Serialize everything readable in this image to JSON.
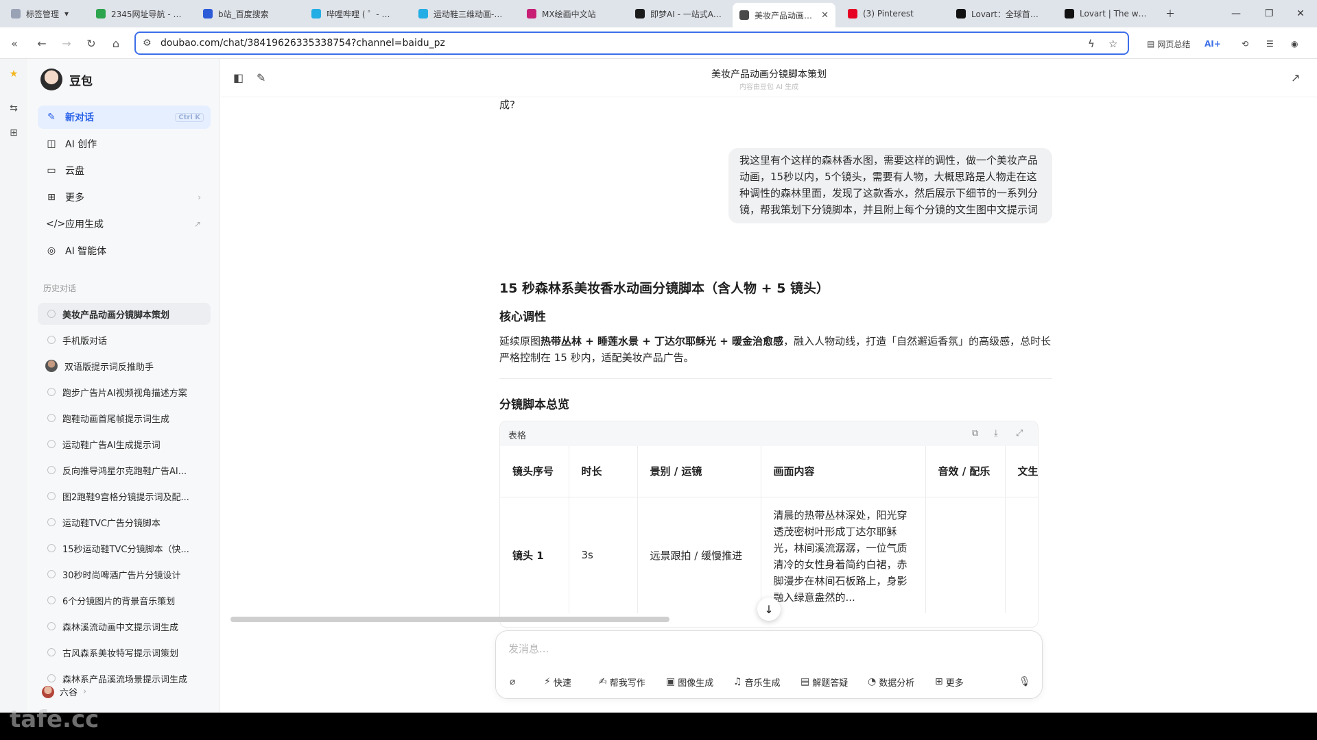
{
  "browser": {
    "bookmarks_label": "标签管理",
    "tabs": [
      {
        "label": "2345网址导航 - 致力...",
        "color": "#2da44e"
      },
      {
        "label": "b站_百度搜索",
        "color": "#2c5bd8"
      },
      {
        "label": "哔哩哔哩 ( ゜- ゜)つロ",
        "color": "#23ade5"
      },
      {
        "label": "运动鞋三维动画-哔哩...",
        "color": "#23ade5"
      },
      {
        "label": "MX绘画中文站",
        "color": "#c81e76"
      },
      {
        "label": "即梦AI - 一站式AI创...",
        "color": "#1b1b1b"
      },
      {
        "label": "美妆产品动画分...",
        "color": "#4a4a4a",
        "active": true
      },
      {
        "label": "(3) Pinterest",
        "color": "#e60023"
      },
      {
        "label": "Lovart：全球首个AI...",
        "color": "#111111"
      },
      {
        "label": "Lovart | The world's...",
        "color": "#111111"
      }
    ],
    "url": "doubao.com/chat/38419626335338754?channel=baidu_pz",
    "page_summary_label": "网页总结",
    "ai_label": "AI+"
  },
  "sidebar": {
    "brand": "豆包",
    "nav": [
      {
        "label": "新对话",
        "icon": "✎",
        "kbd": "Ctrl K",
        "active": true
      },
      {
        "label": "AI 创作",
        "icon": "◫"
      },
      {
        "label": "云盘",
        "icon": "▭"
      },
      {
        "label": "更多",
        "icon": "⊞",
        "arrow": "›"
      },
      {
        "label": "应用生成",
        "icon": "</>",
        "arrow": "↗"
      },
      {
        "label": "AI 智能体",
        "icon": "◎"
      }
    ],
    "history_title": "历史对话",
    "history": [
      {
        "label": "美妆产品动画分镜脚本策划",
        "active": true
      },
      {
        "label": "手机版对话"
      },
      {
        "label": "双语版提示词反推助手",
        "avatar": true
      },
      {
        "label": "跑步广告片AI视频视角描述方案"
      },
      {
        "label": "跑鞋动画首尾帧提示词生成"
      },
      {
        "label": "运动鞋广告AI生成提示词"
      },
      {
        "label": "反向推导鸿星尔克跑鞋广告AI..."
      },
      {
        "label": "图2跑鞋9宫格分镜提示词及配..."
      },
      {
        "label": "运动鞋TVC广告分镜脚本"
      },
      {
        "label": "15秒运动鞋TVC分镜脚本（快..."
      },
      {
        "label": "30秒时尚啤酒广告片分镜设计"
      },
      {
        "label": "6个分镜图片的背景音乐策划"
      },
      {
        "label": "森林溪流动画中文提示词生成"
      },
      {
        "label": "古风森系美妆特写提示词策划"
      },
      {
        "label": "森林系产品溪流场景提示词生成"
      }
    ],
    "user_name": "六谷"
  },
  "header": {
    "title": "美妆产品动画分镜脚本策划",
    "subtitle": "内容由豆包 AI 生成"
  },
  "chat": {
    "prev_tail": "成?",
    "user_message": "我这里有个这样的森林香水图，需要这样的调性，做一个美妆产品动画，15秒以内，5个镜头，需要有人物，大概思路是人物走在这种调性的森林里面，发现了这款香水，然后展示下细节的一系列分镜，帮我策划下分镜脚本，并且附上每个分镜的文生图中文提示词",
    "answer_title": "15 秒森林系美妆香水动画分镜脚本（含人物 + 5 镜头）",
    "core_title": "核心调性",
    "core_prefix": "延续原图",
    "core_bold": "热带丛林 + 睡莲水景 + 丁达尔耶稣光 + 暖金治愈感",
    "core_suffix": "，融入人物动线，打造「自然邂逅香氛」的高级感，总时长严格控制在 15 秒内，适配美妆产品广告。",
    "overview_title": "分镜脚本总览",
    "table": {
      "label": "表格",
      "headers": [
        "镜头序号",
        "时长",
        "景别 / 运镜",
        "画面内容",
        "音效 / 配乐",
        "文生"
      ],
      "row": [
        "镜头 1",
        "3s",
        "远景跟拍 / 缓慢推进",
        "清晨的热带丛林深处，阳光穿透茂密树叶形成丁达尔耶稣光，林间溪流潺潺，一位气质清冷的女性身着简约白裙，赤脚漫步在林间石板路上，身影融入绿意盎然的...",
        "",
        ""
      ]
    }
  },
  "composer": {
    "placeholder": "发消息...",
    "tools": [
      {
        "label": "快速",
        "icon": "⚡"
      },
      {
        "label": "帮我写作",
        "icon": "✍"
      },
      {
        "label": "图像生成",
        "icon": "▣"
      },
      {
        "label": "音乐生成",
        "icon": "♫"
      },
      {
        "label": "解题答疑",
        "icon": "▤"
      },
      {
        "label": "数据分析",
        "icon": "◔"
      },
      {
        "label": "更多",
        "icon": "⊞"
      }
    ]
  },
  "watermark": "tafe.cc"
}
